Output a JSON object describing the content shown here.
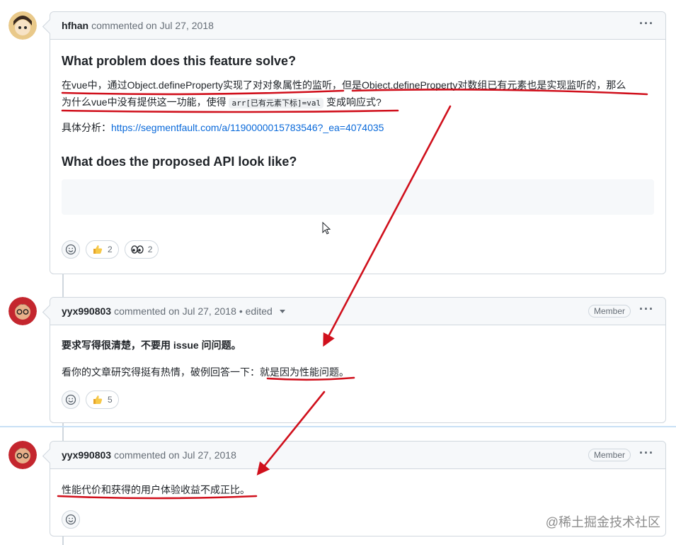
{
  "comments": [
    {
      "author": "hfhan",
      "meta": "commented on Jul 27, 2018",
      "heading1": "What problem does this feature solve?",
      "para1_a": "在vue中，通过Object.defineProperty实现了对对象属性的监听，但是Object.defineProperty对数组已有元素也是实现监听的，那么",
      "para1_b": "为什么vue中没有提供这一功能，使得",
      "code": "arr[已有元素下标]=val",
      "para1_c": "变成响应式?",
      "analysis_label": "具体分析：",
      "analysis_link": "https://segmentfault.com/a/1190000015783546?_ea=4074035",
      "heading2": "What does the proposed API look like?",
      "reactions": [
        {
          "icon": "thumbs-up-icon",
          "count": "2"
        },
        {
          "icon": "eyes-icon",
          "count": "2"
        }
      ]
    },
    {
      "author": "yyx990803",
      "meta": "commented on Jul 27, 2018",
      "edited": "• edited",
      "badge": "Member",
      "bold_line": "要求写得很清楚，不要用 issue 问问题。",
      "para_a": "看你的文章研究得挺有热情，破例回答一下：",
      "para_b": "就是因为性能问题。",
      "reactions": [
        {
          "icon": "thumbs-up-icon",
          "count": "5"
        }
      ]
    },
    {
      "author": "yyx990803",
      "meta": "commented on Jul 27, 2018",
      "badge": "Member",
      "para": "性能代价和获得的用户体验收益不成正比。"
    }
  ],
  "kebab": "···",
  "watermark": "@稀土掘金技术社区",
  "colors": {
    "annotation_red": "#d0101c",
    "link_blue": "#0969da",
    "border": "#d0d7de"
  }
}
